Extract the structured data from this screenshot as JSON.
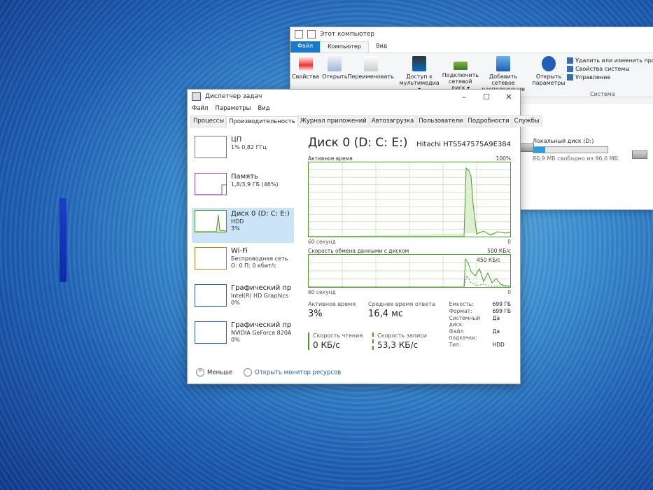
{
  "explorer": {
    "title": "Этот компьютер",
    "tabs": [
      "Файл",
      "Компьютер",
      "Вид"
    ],
    "ribbon": {
      "properties": "Свойства",
      "open": "Открыть",
      "rename": "Переименовать",
      "media_access": "Доступ к мультимедиа ▾",
      "map_drive": "Подключить сетевой диск ▾",
      "add_location": "Добавить сетевое расположение",
      "open_settings": "Открыть параметры",
      "uninstall": "Удалить или изменить програ",
      "system_props": "Свойства системы",
      "manage": "Управление",
      "group_system": "Система"
    },
    "drive": {
      "name": "Локальный диск (D:)",
      "free": "80,9 МБ свободно из 96,0 МБ",
      "used_fraction": 0.16
    }
  },
  "taskmgr": {
    "title": "Диспетчер задач",
    "menu": [
      "Файл",
      "Параметры",
      "Вид"
    ],
    "controls": [
      "–",
      "☐",
      "✕"
    ],
    "tabs": [
      "Процессы",
      "Производительность",
      "Журнал приложений",
      "Автозагрузка",
      "Пользователи",
      "Подробности",
      "Службы"
    ],
    "resources": [
      {
        "name": "ЦП",
        "sub1": "1% 0,82 ГГц",
        "sub2": ""
      },
      {
        "name": "Память",
        "sub1": "1,8/3,9 ГБ (46%)",
        "sub2": ""
      },
      {
        "name": "Диск 0 (D: C: E:)",
        "sub1": "HDD",
        "sub2": "3%"
      },
      {
        "name": "Wi-Fi",
        "sub1": "Беспроводная сеть",
        "sub2": "О: 0 П: 0 кбит/с"
      },
      {
        "name": "Графический про",
        "sub1": "Intel(R) HD Graphics",
        "sub2": "0%"
      },
      {
        "name": "Графический про",
        "sub1": "NVIDIA GeForce 820A",
        "sub2": "0%"
      }
    ],
    "detail": {
      "title": "Диск 0 (D: C: E:)",
      "model": "Hitachi HTS547575A9E384",
      "chart1_label": "Активное время",
      "chart1_max": "100%",
      "chart1_left": "60 секунд",
      "chart1_right": "0",
      "chart2_label": "Скорость обмена данными с диском",
      "chart2_max": "500 КБ/с",
      "chart2_mid": "450 КБ/с",
      "chart2_left": "60 секунд",
      "chart2_right": "0",
      "active_time_label": "Активное время",
      "active_time_value": "3%",
      "avg_response_label": "Среднее время ответа",
      "avg_response_value": "16,4 мс",
      "read_label": "Скорость чтения",
      "read_value": "0 КБ/с",
      "write_label": "Скорость записи",
      "write_value": "53,3 КБ/с",
      "props": [
        {
          "k": "Емкость:",
          "v": "699 ГБ"
        },
        {
          "k": "Формат:",
          "v": "699 ГБ"
        },
        {
          "k": "Системный диск:",
          "v": "Да"
        },
        {
          "k": "Файл подкачки:",
          "v": "Да"
        },
        {
          "k": "Тип:",
          "v": "HDD"
        }
      ]
    },
    "footer": {
      "less": "Меньше",
      "monitor": "Открыть монитор ресурсов"
    }
  }
}
